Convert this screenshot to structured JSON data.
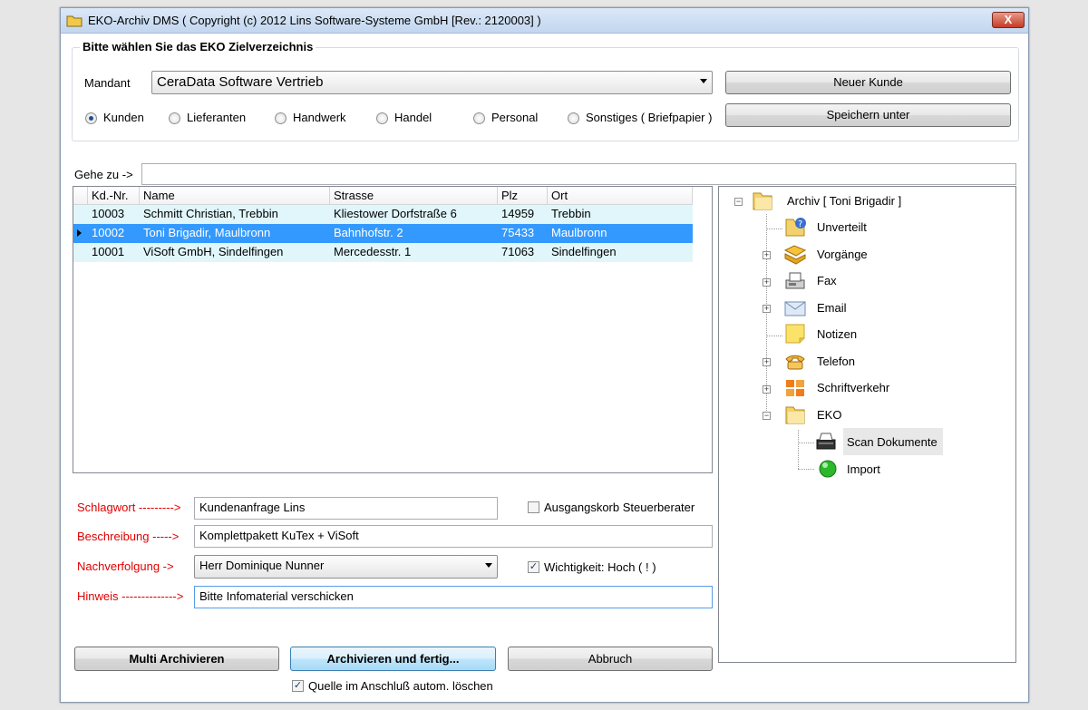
{
  "window": {
    "title": "EKO-Archiv DMS ( Copyright (c) 2012 Lins Software-Systeme GmbH [Rev.: 2120003] )",
    "close": "X"
  },
  "group": {
    "title": "Bitte wählen Sie das EKO Zielverzeichnis"
  },
  "mandant": {
    "label": "Mandant",
    "value": "CeraData Software Vertrieb"
  },
  "buttons": {
    "new_customer": "Neuer Kunde",
    "save_as": "Speichern unter",
    "multi": "Multi Archivieren",
    "archive": "Archivieren und fertig...",
    "cancel": "Abbruch"
  },
  "radios": [
    {
      "label": "Kunden",
      "checked": true
    },
    {
      "label": "Lieferanten",
      "checked": false
    },
    {
      "label": "Handwerk",
      "checked": false
    },
    {
      "label": "Handel",
      "checked": false
    },
    {
      "label": "Personal",
      "checked": false
    },
    {
      "label": "Sonstiges ( Briefpapier )",
      "checked": false
    }
  ],
  "goto": {
    "label": "Gehe zu ->",
    "value": ""
  },
  "grid": {
    "headers": [
      "Kd.-Nr.",
      "Name",
      "Strasse",
      "Plz",
      "Ort"
    ],
    "rows": [
      [
        "10003",
        "Schmitt Christian, Trebbin",
        "Kliestower Dorfstraße 6",
        "14959",
        "Trebbin"
      ],
      [
        "10002",
        "Toni Brigadir, Maulbronn",
        "Bahnhofstr. 2",
        "75433",
        "Maulbronn"
      ],
      [
        "10001",
        "ViSoft GmbH, Sindelfingen",
        "Mercedesstr. 1",
        "71063",
        "Sindelfingen"
      ]
    ],
    "selected_row": 1
  },
  "form": {
    "schlagwort_label": "Schlagwort --------->",
    "schlagwort_value": "Kundenanfrage Lins",
    "beschreibung_label": "Beschreibung ----->",
    "beschreibung_value": "Komplettpakett KuTex + ViSoft",
    "nachverfolgung_label": "Nachverfolgung ->",
    "nachverfolgung_value": "Herr Dominique Nunner",
    "hinweis_label": "Hinweis -------------->",
    "hinweis_value": "Bitte Infomaterial verschicken",
    "ausgangskorb_label": "Ausgangskorb Steuerberater",
    "wichtigkeit_label": "Wichtigkeit: Hoch ( ! )",
    "quelle_label": "Quelle im Anschluß autom. löschen"
  },
  "tree": {
    "root": "Archiv [ Toni Brigadir ]",
    "items": [
      "Unverteilt",
      "Vorgänge",
      "Fax",
      "Email",
      "Notizen",
      "Telefon",
      "Schriftverkehr",
      "EKO"
    ],
    "eko_children": [
      "Scan Dokumente",
      "Import"
    ]
  },
  "colors": {
    "selection": "#3399ff",
    "row_alt": "#e0f6fb",
    "label_red": "#e00000"
  }
}
